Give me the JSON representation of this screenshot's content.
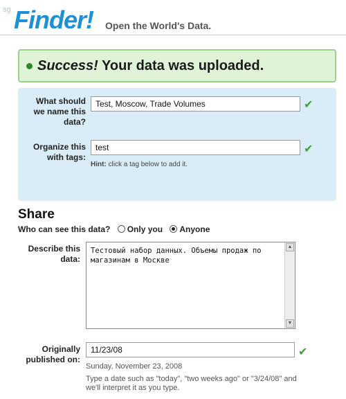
{
  "header": {
    "logo_mark": "sg",
    "logo_text": "Finder!",
    "tagline": "Open the World's Data."
  },
  "banner": {
    "success_word": "Success!",
    "message": " Your data was uploaded."
  },
  "form": {
    "name": {
      "label_line1": "What should",
      "label_line2": "we name this",
      "label_line3": "data?",
      "value": "Test, Moscow, Trade Volumes"
    },
    "tags": {
      "label_line1": "Organize this",
      "label_line2": "with tags:",
      "value": "test",
      "hint_label": "Hint:",
      "hint_text": " click a tag below to add it."
    }
  },
  "share": {
    "title": "Share",
    "question": "Who can see this data?",
    "options": [
      {
        "label": "Only you",
        "selected": false
      },
      {
        "label": "Anyone",
        "selected": true
      }
    ],
    "describe_label_line1": "Describe this",
    "describe_label_line2": "data:",
    "description": "Тестовый набор данных. Объемы продаж по магазинам в Москве",
    "published_label_line1": "Originally",
    "published_label_line2": "published on:",
    "published_value": "11/23/08",
    "published_readout": "Sunday, November 23, 2008",
    "date_help_line1": "Type a date such as \"today\", \"two weeks ago\" or \"3/24/08\" and",
    "date_help_line2": "we'll interpret it as you type."
  },
  "colors": {
    "brand": "#1e90d6",
    "success_bg": "#dff3d6",
    "success_border": "#9bd28a",
    "panel_bg": "#d9ecf7",
    "check": "#3aa03a"
  },
  "icons": {
    "check": "check-icon",
    "bullet": "success-dot-icon",
    "radio": "radio-icon",
    "scroll_up": "arrow-up-icon",
    "scroll_down": "arrow-down-icon"
  }
}
